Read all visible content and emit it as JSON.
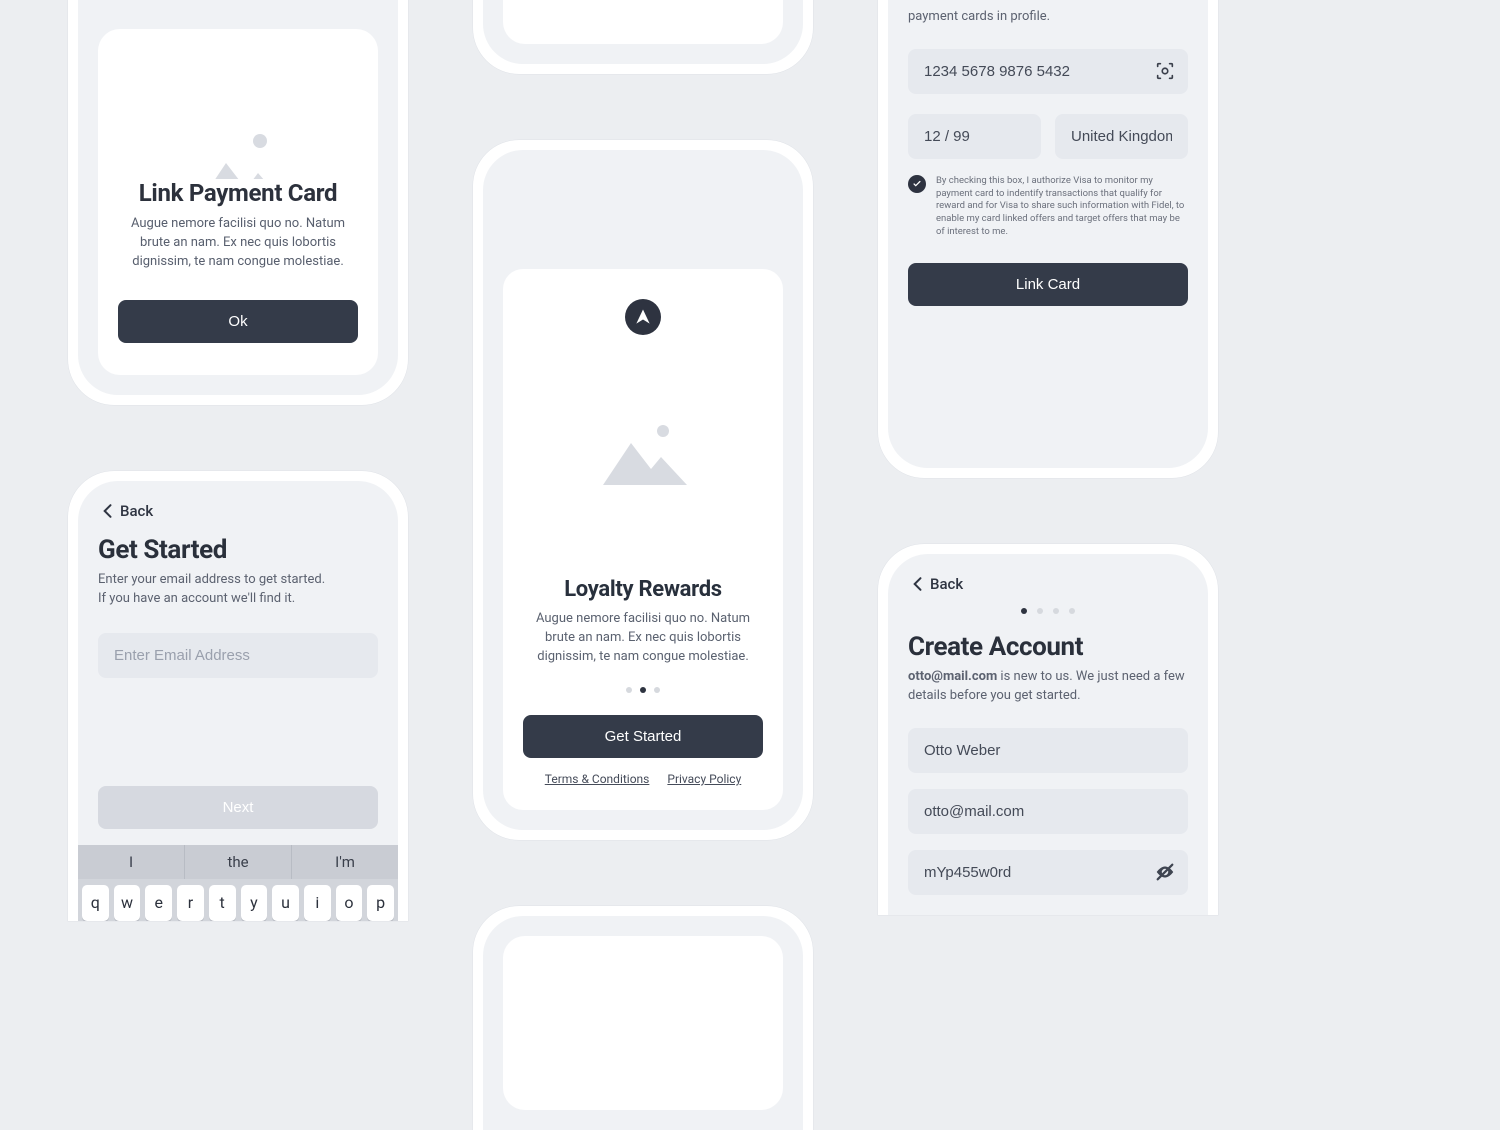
{
  "colors": {
    "accent": "#343b49"
  },
  "modal_link": {
    "title": "Link Payment Card",
    "body": "Augue nemore facilisi quo no. Natum brute an nam. Ex nec quis lobortis dignissim, te nam congue molestiae.",
    "ok": "Ok"
  },
  "get_started": {
    "back": "Back",
    "title": "Get Started",
    "sub1": "Enter your email address to get started.",
    "sub2": "If you have an account we'll find it.",
    "email_placeholder": "Enter Email Address",
    "next": "Next",
    "suggestions": [
      "I",
      "the",
      "I'm"
    ],
    "keys_row1": [
      "q",
      "w",
      "e",
      "r",
      "t",
      "y",
      "u",
      "i",
      "o",
      "p"
    ]
  },
  "loyalty": {
    "title": "Loyalty Rewards",
    "body": "Augue nemore facilisi quo no. Natum brute an nam. Ex nec quis lobortis dignissim, te nam congue molestiae.",
    "cta": "Get Started",
    "terms": "Terms & Conditions",
    "privacy": "Privacy Policy",
    "active_dot": 1
  },
  "link_card": {
    "intro": "payment cards in profile.",
    "cardno": "1234 5678 9876 5432",
    "expiry": "12 / 99",
    "country": "United Kingdom",
    "consent": "By checking this box, I authorize Visa to monitor my payment card to indentify transactions that qualify for reward and for Visa to share such information with Fidel, to enable my card linked offers and target offers that may be of interest to me.",
    "cta": "Link Card"
  },
  "create": {
    "back": "Back",
    "title": "Create Account",
    "email": "otto@mail.com",
    "desc_rest": " is new to us. We just need a few details before you get started.",
    "name": "Otto Weber",
    "password": "mYp455w0rd",
    "active_step": 0
  }
}
